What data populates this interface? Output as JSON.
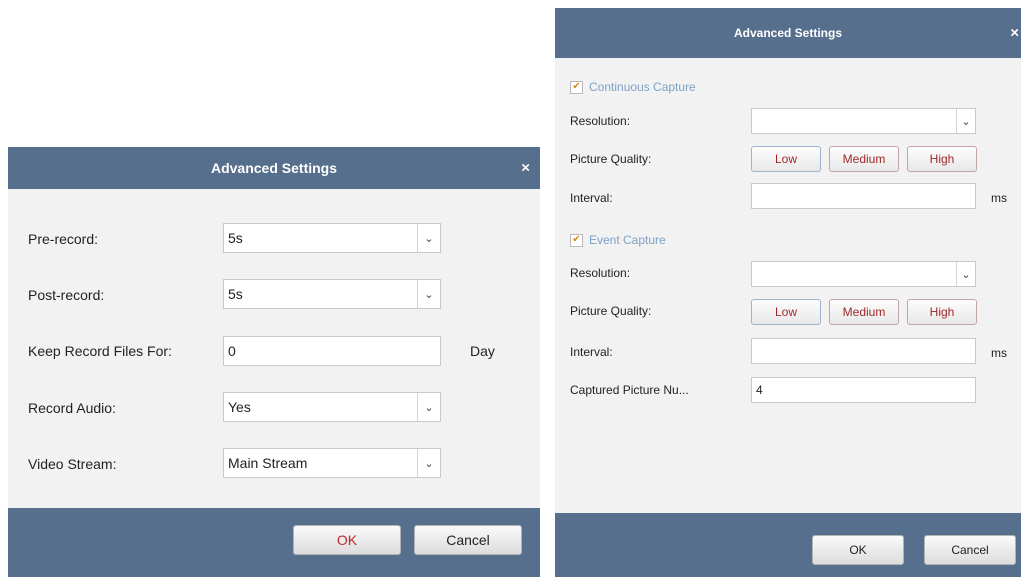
{
  "left_dialog": {
    "title": "Advanced Settings",
    "close_glyph": "×",
    "fields": {
      "pre_record": {
        "label": "Pre-record:",
        "value": "5s"
      },
      "post_record": {
        "label": "Post-record:",
        "value": "5s"
      },
      "keep_record": {
        "label": "Keep Record Files For:",
        "value": "0",
        "unit": "Day"
      },
      "record_audio": {
        "label": "Record Audio:",
        "value": "Yes"
      },
      "video_stream": {
        "label": "Video Stream:",
        "value": "Main Stream"
      }
    },
    "ok_label": "OK",
    "cancel_label": "Cancel"
  },
  "right_dialog": {
    "title": "Advanced Settings",
    "close_glyph": "×",
    "continuous": {
      "title": "Continuous Capture",
      "checked": true,
      "resolution_label": "Resolution:",
      "resolution_value": "",
      "quality_label": "Picture Quality:",
      "quality_options": [
        "Low",
        "Medium",
        "High"
      ],
      "interval_label": "Interval:",
      "interval_value": "",
      "interval_unit": "ms"
    },
    "event": {
      "title": "Event Capture",
      "checked": true,
      "resolution_label": "Resolution:",
      "resolution_value": "",
      "quality_label": "Picture Quality:",
      "quality_options": [
        "Low",
        "Medium",
        "High"
      ],
      "interval_label": "Interval:",
      "interval_value": "",
      "interval_unit": "ms",
      "captured_label": "Captured Picture Nu...",
      "captured_value": "4"
    },
    "ok_label": "OK",
    "cancel_label": "Cancel"
  },
  "icons": {
    "dropdown_arrow": "⌄",
    "check": "✔"
  },
  "colors": {
    "titlebar": "#566f8d",
    "body": "#f2f2f2",
    "ok_text": "#c0282b",
    "section_text": "#7ea2c5"
  }
}
